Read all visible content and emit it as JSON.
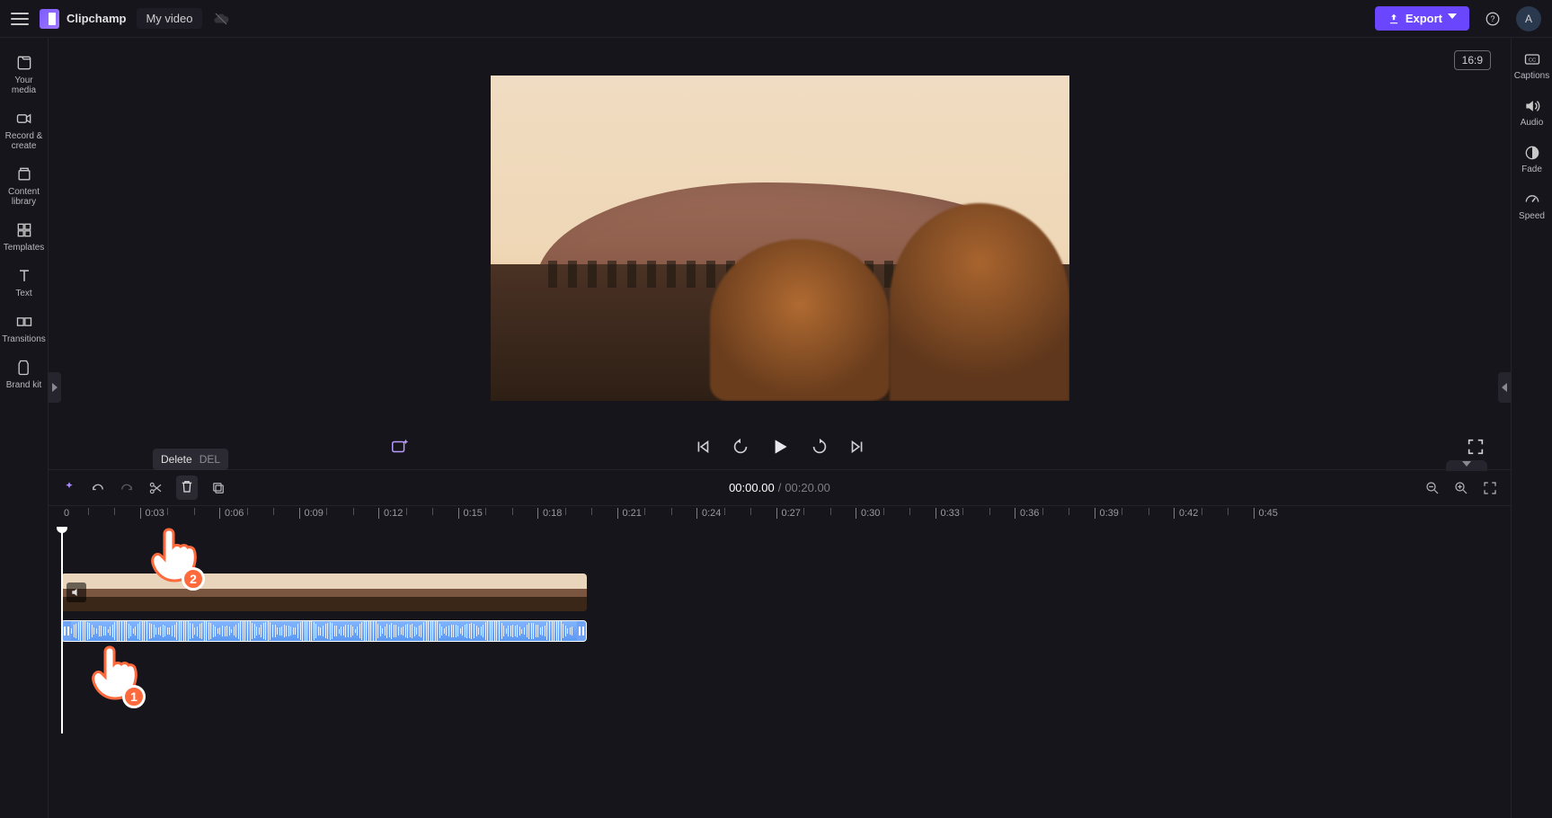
{
  "app": {
    "name": "Clipchamp",
    "project_title": "My video"
  },
  "header": {
    "export_label": "Export",
    "avatar_letter": "A"
  },
  "left_sidebar": {
    "items": [
      {
        "label": "Your media",
        "icon": "media-icon"
      },
      {
        "label": "Record & create",
        "icon": "record-icon"
      },
      {
        "label": "Content library",
        "icon": "library-icon"
      },
      {
        "label": "Templates",
        "icon": "templates-icon"
      },
      {
        "label": "Text",
        "icon": "text-icon"
      },
      {
        "label": "Transitions",
        "icon": "transitions-icon"
      },
      {
        "label": "Brand kit",
        "icon": "brandkit-icon"
      }
    ]
  },
  "right_sidebar": {
    "items": [
      {
        "label": "Captions",
        "icon": "captions-icon"
      },
      {
        "label": "Audio",
        "icon": "audio-icon"
      },
      {
        "label": "Fade",
        "icon": "fade-icon"
      },
      {
        "label": "Speed",
        "icon": "speed-icon"
      }
    ]
  },
  "preview": {
    "aspect_ratio": "16:9"
  },
  "playback": {
    "current_time": "00:00.00",
    "duration": "00:20.00",
    "separator": "/"
  },
  "tooltip": {
    "label": "Delete",
    "shortcut": "DEL"
  },
  "ruler": {
    "start_label": "0",
    "marks": [
      "0:03",
      "0:06",
      "0:09",
      "0:12",
      "0:15",
      "0:18",
      "0:21",
      "0:24",
      "0:27",
      "0:30",
      "0:33",
      "0:36",
      "0:39",
      "0:42",
      "0:45"
    ]
  },
  "annotations": {
    "step1": "1",
    "step2": "2"
  },
  "colors": {
    "accent": "#6a46ff",
    "annotation": "#ff6a3d",
    "audio_clip": "#5b99f2"
  }
}
